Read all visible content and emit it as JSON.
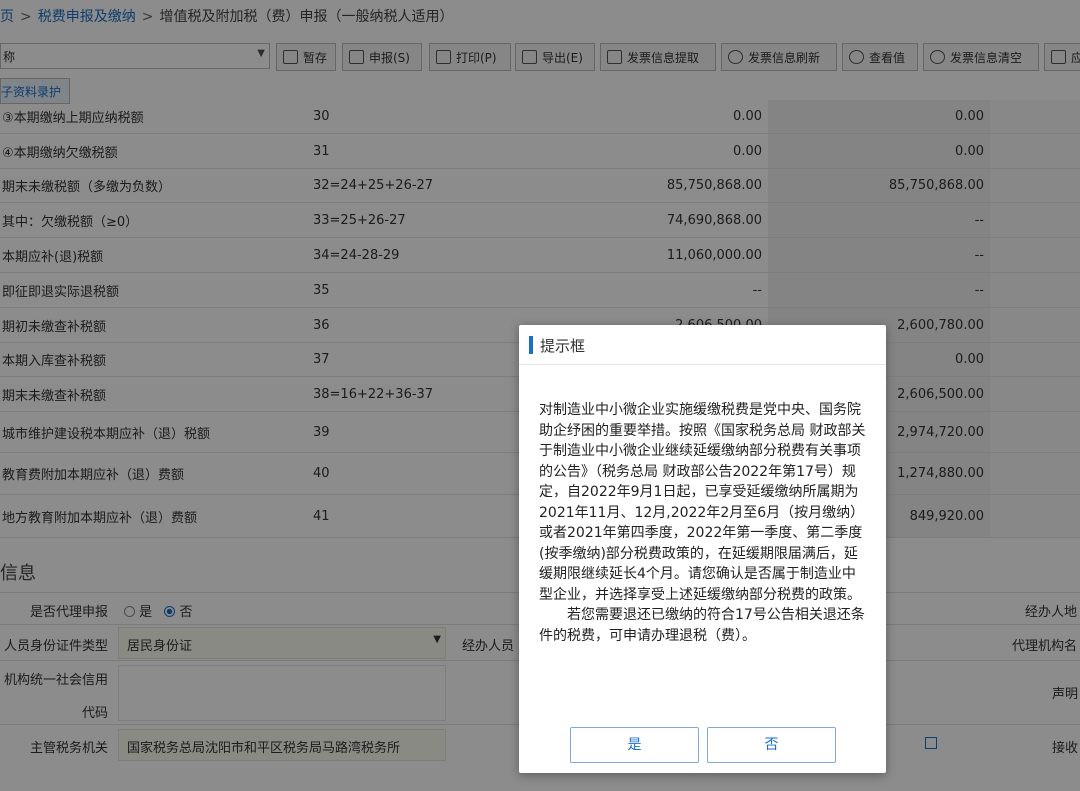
{
  "breadcrumb": {
    "home_fragment": "页",
    "sep1": ">",
    "link": "税费申报及缴纳",
    "sep2": ">",
    "current": "增值税及附加税（费）申报（一般纳税人适用）"
  },
  "toolbar": {
    "select_value": "称",
    "buttons": {
      "save": "暂存",
      "submit": "申报(S)",
      "print": "打印(P)",
      "export": "导出(E)",
      "invoice_fetch": "发票信息提取",
      "invoice_refresh": "发票信息刷新",
      "check": "查看值",
      "invoice_clear": "发票信息清空",
      "more": "应"
    }
  },
  "tab_label": "子资料录护",
  "table_rows": [
    {
      "name": "③本期缴纳上期应纳税额",
      "code": "30",
      "v1": "0.00",
      "v2": "0.00"
    },
    {
      "name": "④本期缴纳欠缴税额",
      "code": "31",
      "v1": "0.00",
      "v2": "0.00"
    },
    {
      "name": "期末未缴税额（多缴为负数）",
      "code": "32=24+25+26-27",
      "v1": "85,750,868.00",
      "v2": "85,750,868.00"
    },
    {
      "name": "其中：欠缴税额（≥0）",
      "code": "33=25+26-27",
      "v1": "74,690,868.00",
      "v2": "--"
    },
    {
      "name": "本期应补(退)税额",
      "code": "34=24-28-29",
      "v1": "11,060,000.00",
      "v2": "--"
    },
    {
      "name": "即征即退实际退税额",
      "code": "35",
      "v1": "--",
      "v2": "--"
    },
    {
      "name": "期初未缴查补税额",
      "code": "36",
      "v1": "2,606,500.00",
      "v2": "2,600,780.00"
    },
    {
      "name": "本期入库查补税额",
      "code": "37",
      "v1": "",
      "v2": "0.00"
    },
    {
      "name": "期末未缴查补税额",
      "code": "38=16+22+36-37",
      "v1": "",
      "v2": "2,606,500.00"
    },
    {
      "name": "城市维护建设税本期应补（退）税额",
      "code": "39",
      "v1": "",
      "v2": "2,974,720.00"
    },
    {
      "name": "教育费附加本期应补（退）费额",
      "code": "40",
      "v1": "",
      "v2": "1,274,880.00"
    },
    {
      "name": "地方教育附加本期应补（退）费额",
      "code": "41",
      "v1": "",
      "v2": "849,920.00"
    }
  ],
  "section_title": "信息",
  "form": {
    "agent_label": "是否代理申报",
    "agent_yes": "是",
    "agent_no": "否",
    "agent_person_label": "经办人地",
    "id_type_label": "人员身份证件类型",
    "id_type_value": "居民身份证",
    "handler_label": "经办人员",
    "agency_name_label": "代理机构名",
    "credit_code_label_1": "机构统一社会信用",
    "credit_code_label_2": "代码",
    "declare_label": "声明",
    "tax_office_label": "主管税务机关",
    "tax_office_value": "国家税务总局沈阳市和平区税务局马路湾税务所",
    "receiver_label": "接收"
  },
  "dialog": {
    "title": "提示框",
    "paragraph1": "对制造业中小微企业实施缓缴税费是党中央、国务院助企纾困的重要举措。按照《国家税务总局 财政部关于制造业中小微企业继续延缓缴纳部分税费有关事项的公告》（税务总局 财政部公告2022年第17号）规定，自2022年9月1日起，已享受延缓缴纳所属期为2021年11月、12月,2022年2月至6月（按月缴纳）或者2021年第四季度，2022年第一季度、第二季度(按季缴纳)部分税费政策的，在延缓期限届满后，延缓期限继续延长4个月。请您确认是否属于制造业中型企业，并选择享受上述延缓缴纳部分税费的政策。",
    "paragraph2": "若您需要退还已缴纳的符合17号公告相关退还条件的税费，可申请办理退税（费）。",
    "yes_label": "是",
    "no_label": "否"
  },
  "colors": {
    "accent": "#1a6fc9",
    "overlay": "rgba(0,0,0,0.45)"
  }
}
